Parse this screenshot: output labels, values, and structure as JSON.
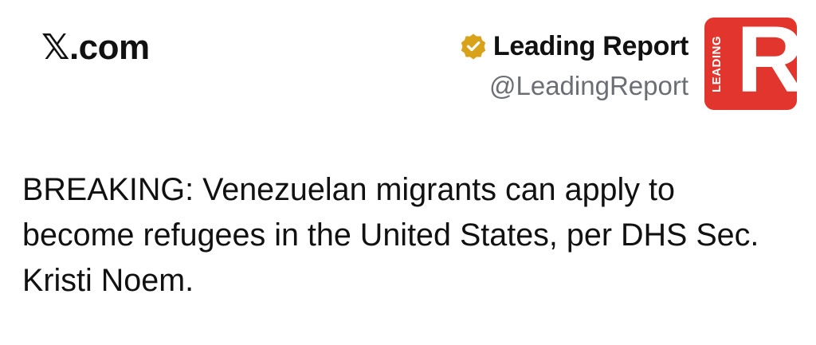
{
  "header": {
    "site_label": "𝕏.com"
  },
  "author": {
    "name": "Leading Report",
    "handle": "@LeadingReport",
    "verified_badge_icon": "verified-badge-icon",
    "verified_badge_color": "#d9a21b",
    "avatar": {
      "icon": "leading-report-logo-icon",
      "letter": "R",
      "word": "LEADING",
      "background": "#e2352d"
    }
  },
  "tweet": {
    "text": "BREAKING: Venezuelan migrants can apply to become refugees in the United States, per DHS Sec. Kristi Noem."
  }
}
